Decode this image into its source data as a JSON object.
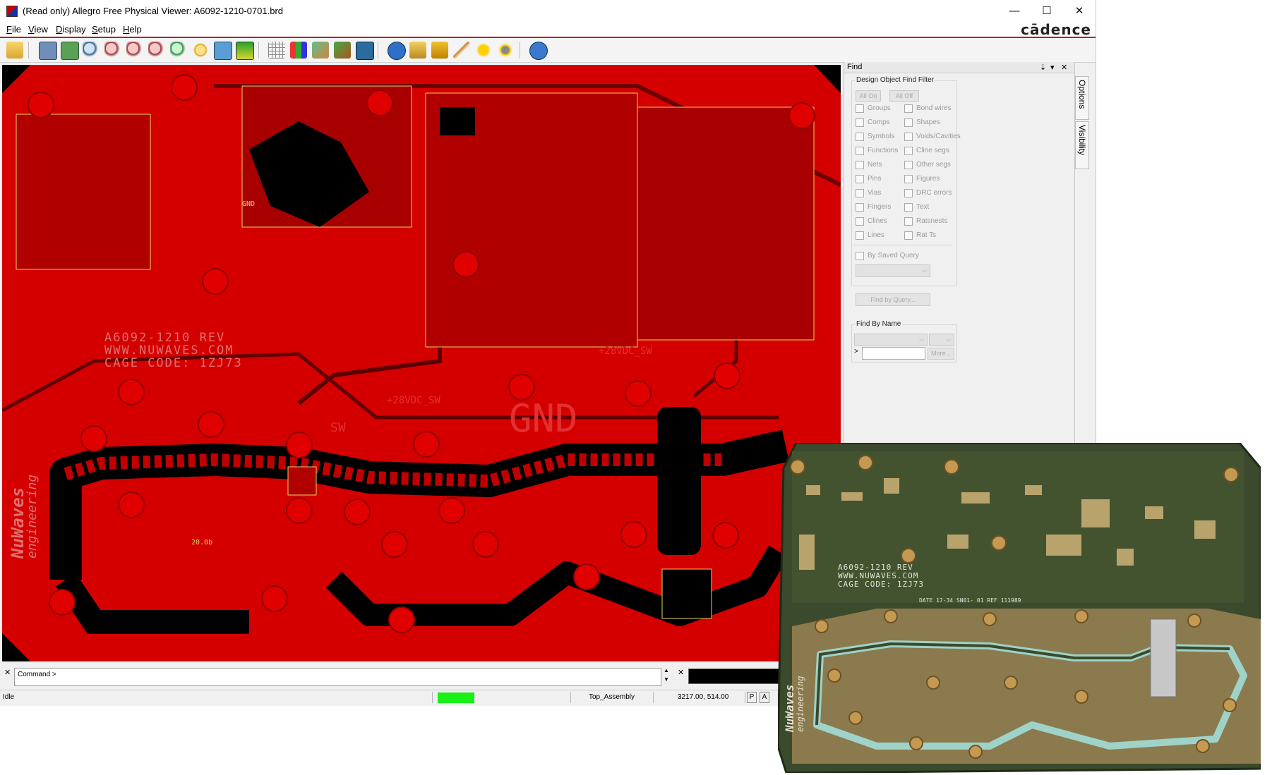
{
  "window": {
    "title": "(Read only) Allegro Free Physical Viewer: A6092-1210-0701.brd",
    "minimize": "—",
    "maximize": "☐",
    "close": "✕"
  },
  "menu": {
    "items": [
      {
        "u": "F",
        "rest": "ile"
      },
      {
        "u": "V",
        "rest": "iew"
      },
      {
        "u": "D",
        "rest": "isplay"
      },
      {
        "u": "S",
        "rest": "etup"
      },
      {
        "u": "H",
        "rest": "elp"
      }
    ],
    "brand": "cādence"
  },
  "toolbar": {
    "icons": [
      "open-icon",
      "zoom-fit-icon",
      "zoom-world-icon",
      "zoom-in-icon",
      "zoom-points-icon",
      "zoom-in2-icon",
      "zoom-out-icon",
      "zoom-previous-icon",
      "redraw-icon",
      "3d-view-icon",
      "flip-icon",
      "grid-icon",
      "color-icon",
      "layers-icon",
      "shadow-icon",
      "visibility-icon",
      "info-icon",
      "properties-icon",
      "measure-icon",
      "highlight-icon",
      "dehighlight-icon",
      "assign-color-icon",
      "help-icon"
    ]
  },
  "board": {
    "silk_line1": "A6092-1210 REV",
    "silk_line2": "WWW.NUWAVES.COM",
    "silk_line3": "CAGE CODE: 1ZJ73",
    "gnd_big": "GND",
    "gnd_small": "GND",
    "net_28v_a": "+28VDC_SW",
    "net_28v_b": "+28VDC_SW",
    "sw_label": "SW",
    "att_label": "20.0b",
    "brand_line1": "NuWaves",
    "brand_line2": "engineering",
    "colors": {
      "copper": "#d40000",
      "dark": "#8a0000",
      "void": "#000000",
      "outline": "#e6d35a"
    }
  },
  "find": {
    "title": "Find",
    "pin": "⇣",
    "menu": "▾",
    "close": "✕",
    "filter_title": "Design Object Find Filter",
    "all_on": "All On",
    "all_off": "All Off",
    "left_items": [
      "Groups",
      "Comps",
      "Symbols",
      "Functions",
      "Nets",
      "Pins",
      "Vias",
      "Fingers",
      "Clines",
      "Lines"
    ],
    "right_items": [
      "Bond wires",
      "Shapes",
      "Voids/Cavities",
      "Cline segs",
      "Other segs",
      "Figures",
      "DRC errors",
      "Text",
      "Ratsnests",
      "Rat Ts"
    ],
    "by_saved_query": "By Saved Query",
    "find_by_query": "Find by Query...",
    "find_by_name": "Find By Name",
    "name_prompt": ">",
    "more": "More..."
  },
  "side_tabs": {
    "options": "Options",
    "visibility": "Visibility"
  },
  "command": {
    "label": "Command >",
    "up": "▲",
    "down": "▼",
    "close": "✕"
  },
  "status": {
    "state": "Idle",
    "subclass": "Top_Assembly",
    "coords": "3217.00, 514.00",
    "p": "P",
    "a": "A"
  },
  "photo": {
    "silk_line1": "A6092-1210 REV",
    "silk_line2": "WWW.NUWAVES.COM",
    "silk_line3": "CAGE CODE: 1ZJ73",
    "date_line": "DATE 17-34  SN01- 01    REF 111989",
    "brand_line1": "NuWaves",
    "brand_line2": "engineering"
  }
}
